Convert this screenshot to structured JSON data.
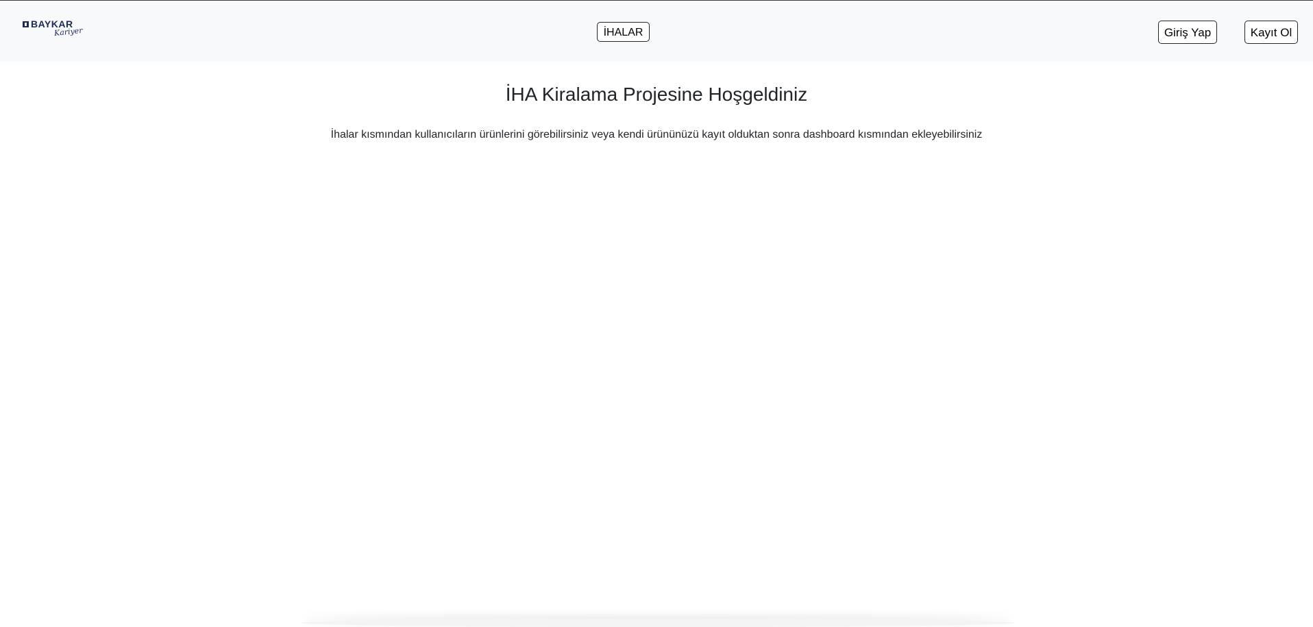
{
  "header": {
    "logo": {
      "brand": "BAYKAR",
      "script": "Kariyer"
    },
    "nav": {
      "ihalar_label": "İHALAR"
    },
    "auth": {
      "login_label": "Giriş Yap",
      "register_label": "Kayıt Ol"
    }
  },
  "main": {
    "title": "İHA Kiralama Projesine Hoşgeldiniz",
    "description": "İhalar kısmından kullanıcıların ürünlerini görebilirsiniz veya kendi ürününüzü kayıt olduktan sonra dashboard kısmından ekleyebilirsiniz"
  },
  "colors": {
    "navbar_background": "#f8f9fa",
    "brand": "#1c2a56",
    "text": "#212529"
  }
}
